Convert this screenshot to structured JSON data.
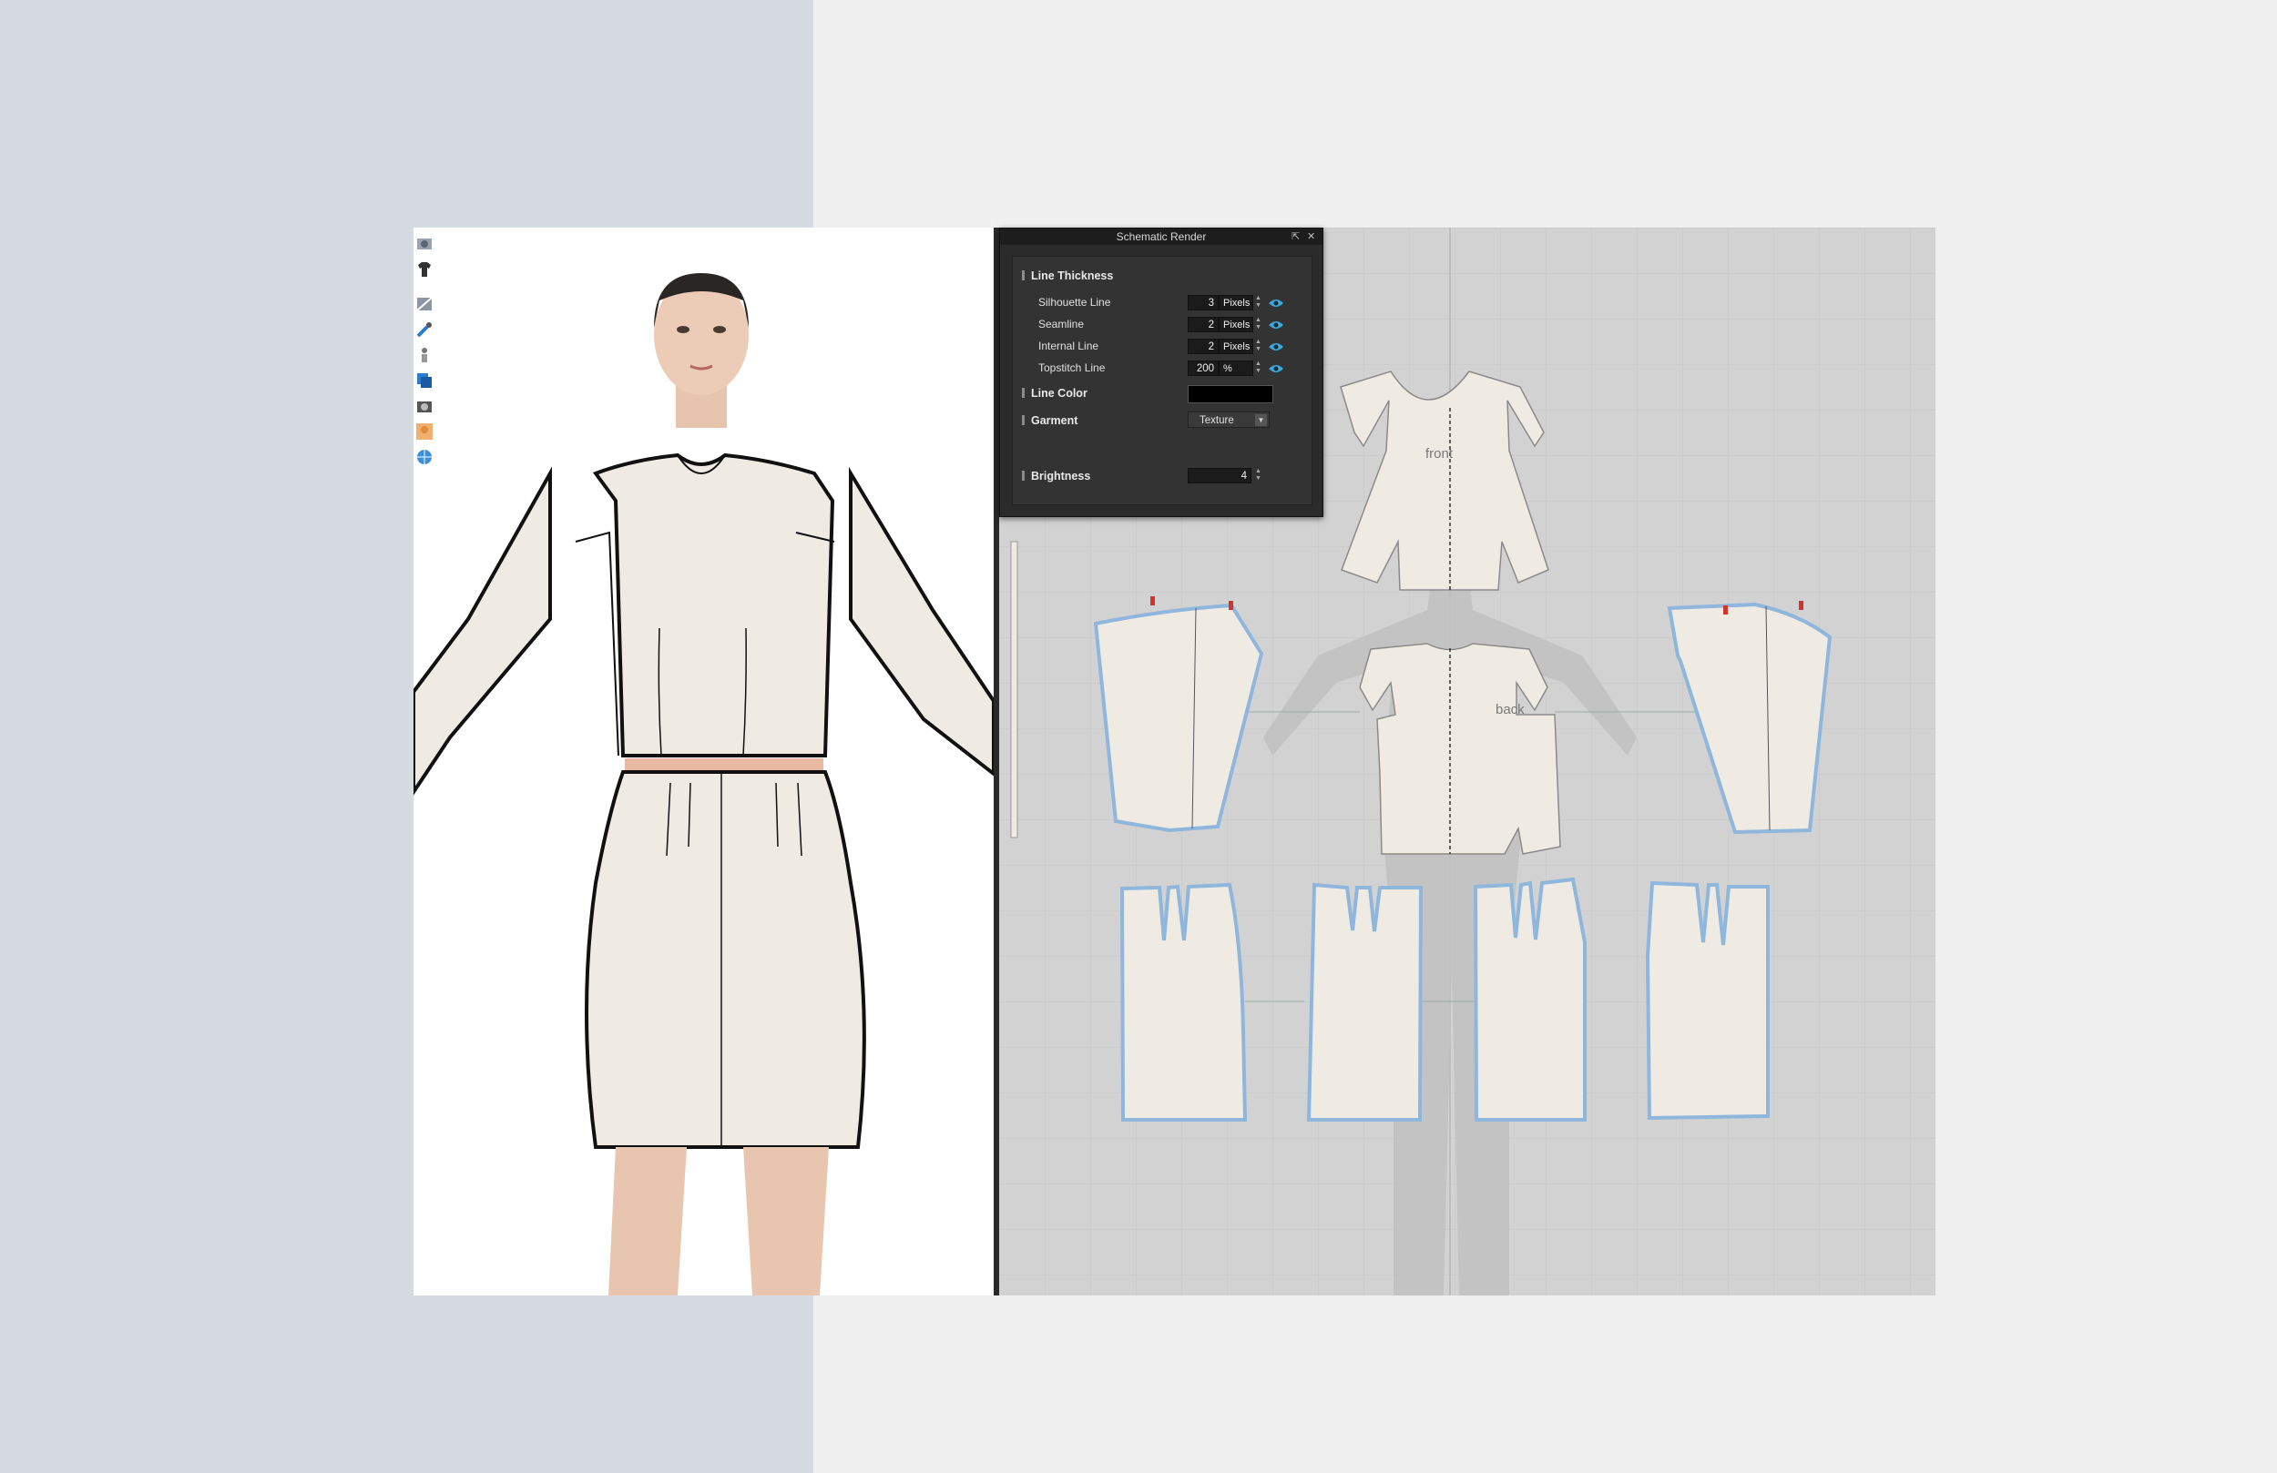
{
  "panel": {
    "title": "Schematic Render",
    "pin_glyph": "⇱",
    "close_glyph": "✕",
    "sections": {
      "line_thickness": "Line Thickness",
      "line_color": "Line Color",
      "garment": "Garment",
      "brightness": "Brightness"
    },
    "rows": [
      {
        "label": "Silhouette Line",
        "value": "3",
        "unit": "Pixels"
      },
      {
        "label": "Seamline",
        "value": "2",
        "unit": "Pixels"
      },
      {
        "label": "Internal Line",
        "value": "2",
        "unit": "Pixels"
      },
      {
        "label": "Topstitch Line",
        "value": "200",
        "unit": "%"
      }
    ],
    "line_color": "#000000",
    "garment_value": "Texture",
    "brightness_value": "4"
  },
  "pattern": {
    "front_label": "front",
    "back_label": "back"
  },
  "toolbar_icons": [
    "avatar-display-icon",
    "garment-display-icon",
    "texture-icon",
    "brush-icon",
    "figure-icon",
    "layers-icon",
    "camera-icon",
    "skin-icon",
    "globe-icon"
  ],
  "colors": {
    "fabric": "#efebe3",
    "seam_highlight": "#8fb6dc",
    "notch": "#d0342c",
    "eye_icon": "#3aa9dc",
    "panel_bg": "#2b2b2b"
  }
}
